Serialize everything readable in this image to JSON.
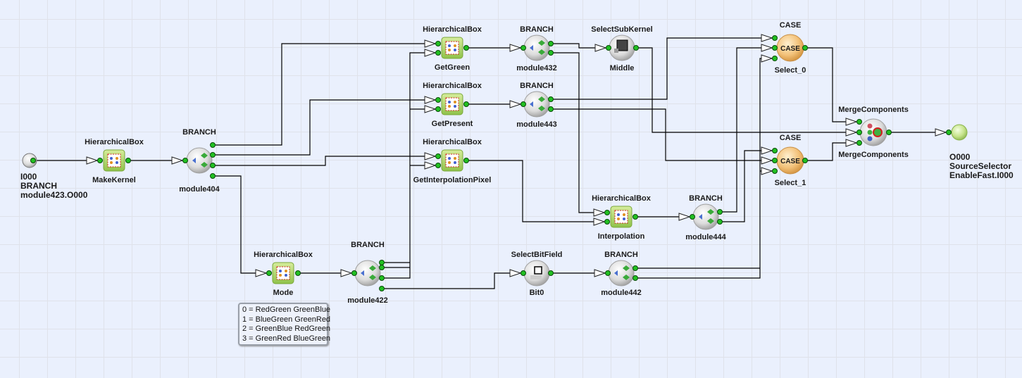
{
  "colors": {
    "background": "#eaf0fd",
    "port": "#22c022",
    "hbox": "#a6d35c",
    "case": "#f0b860",
    "output": "#c5e38a"
  },
  "nodes": [
    {
      "id": "in0",
      "type": "input",
      "lines": [
        "I000",
        "BRANCH",
        "module423.O000"
      ],
      "icon": "input-port-icon"
    },
    {
      "id": "makekernel",
      "type": "hbox",
      "title": "HierarchicalBox",
      "label": "MakeKernel",
      "icon": "hierarchical-box-icon"
    },
    {
      "id": "m404",
      "type": "branch",
      "title": "BRANCH",
      "label": "module404",
      "icon": "branch-icon"
    },
    {
      "id": "getgreen",
      "type": "hbox",
      "title": "HierarchicalBox",
      "label": "GetGreen",
      "icon": "hierarchical-box-icon"
    },
    {
      "id": "getpresent",
      "type": "hbox",
      "title": "HierarchicalBox",
      "label": "GetPresent",
      "icon": "hierarchical-box-icon"
    },
    {
      "id": "getinterp",
      "type": "hbox",
      "title": "HierarchicalBox",
      "label": "GetInterpolationPixel",
      "icon": "hierarchical-box-icon"
    },
    {
      "id": "m432",
      "type": "branch",
      "title": "BRANCH",
      "label": "module432",
      "icon": "branch-icon"
    },
    {
      "id": "m443",
      "type": "branch",
      "title": "BRANCH",
      "label": "module443",
      "icon": "branch-icon"
    },
    {
      "id": "middle",
      "type": "subkernel",
      "title": "SelectSubKernel",
      "label": "Middle",
      "icon": "sub-kernel-icon"
    },
    {
      "id": "select0",
      "type": "case",
      "title": "CASE",
      "label": "Select_0",
      "badge": "CASE",
      "icon": "case-icon"
    },
    {
      "id": "select1",
      "type": "case",
      "title": "CASE",
      "label": "Select_1",
      "badge": "CASE",
      "icon": "case-icon"
    },
    {
      "id": "merge",
      "type": "merge",
      "title": "MergeComponents",
      "label": "MergeComponents",
      "icon": "merge-components-icon"
    },
    {
      "id": "out0",
      "type": "output",
      "lines": [
        "O000",
        "SourceSelector",
        "EnableFast.I000"
      ],
      "icon": "output-port-icon"
    },
    {
      "id": "interp",
      "type": "hbox",
      "title": "HierarchicalBox",
      "label": "Interpolation",
      "icon": "hierarchical-box-icon"
    },
    {
      "id": "m444",
      "type": "branch",
      "title": "BRANCH",
      "label": "module444",
      "icon": "branch-icon"
    },
    {
      "id": "mode",
      "type": "hbox",
      "title": "HierarchicalBox",
      "label": "Mode",
      "icon": "hierarchical-box-icon"
    },
    {
      "id": "m422",
      "type": "branch",
      "title": "BRANCH",
      "label": "module422",
      "icon": "branch-icon"
    },
    {
      "id": "bit0",
      "type": "bitfield",
      "title": "SelectBitField",
      "label": "Bit0",
      "icon": "bit-field-icon"
    },
    {
      "id": "m442",
      "type": "branch",
      "title": "BRANCH",
      "label": "module442",
      "icon": "branch-icon"
    }
  ],
  "legend": {
    "lines": [
      "0 = RedGreen GreenBlue",
      "1 = BlueGreen GreenRed",
      "2 = GreenBlue RedGreen",
      "3 = GreenRed BlueGreen"
    ]
  }
}
